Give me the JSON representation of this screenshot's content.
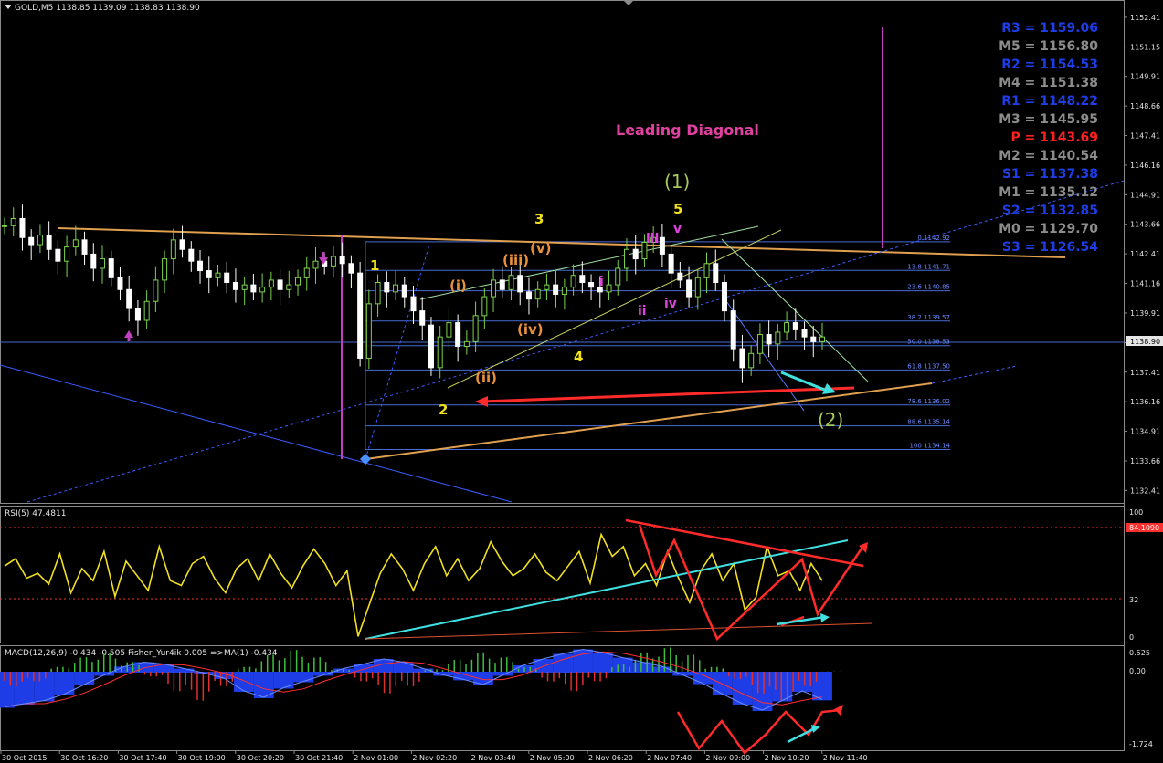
{
  "symbol_header": "GOLD,M5  1138.85 1139.09 1138.83 1138.90",
  "annotations": {
    "leading_diagonal": "Leading Diagonal",
    "wave_1_major": "(1)",
    "wave_2_major": "(2)",
    "wave_1": "1",
    "wave_2": "2",
    "wave_3": "3",
    "wave_4": "4",
    "wave_5": "5",
    "sub_i": "(i)",
    "sub_ii": "(ii)",
    "sub_iii": "(iii)",
    "sub_iv": "(iv)",
    "sub_v": "(v)",
    "m_i": "i",
    "m_ii": "ii",
    "m_iii": "iii",
    "m_iv": "iv",
    "m_v": "v"
  },
  "pivots": [
    {
      "label": "R3",
      "value": "1159.06",
      "color": "#1f3de6"
    },
    {
      "label": "M5",
      "value": "1156.80",
      "color": "#8c8c8c"
    },
    {
      "label": "R2",
      "value": "1154.53",
      "color": "#1f3de6"
    },
    {
      "label": "M4",
      "value": "1151.38",
      "color": "#8c8c8c"
    },
    {
      "label": "R1",
      "value": "1148.22",
      "color": "#1f3de6"
    },
    {
      "label": "M3",
      "value": "1145.95",
      "color": "#8c8c8c"
    },
    {
      "label": "P",
      "value": "1143.69",
      "color": "#ff2020"
    },
    {
      "label": "M2",
      "value": "1140.54",
      "color": "#8c8c8c"
    },
    {
      "label": "S1",
      "value": "1137.38",
      "color": "#1f3de6"
    },
    {
      "label": "M1",
      "value": "1135.12",
      "color": "#8c8c8c"
    },
    {
      "label": "S2",
      "value": "1132.85",
      "color": "#1f3de6"
    },
    {
      "label": "M0",
      "value": "1129.70",
      "color": "#8c8c8c"
    },
    {
      "label": "S3",
      "value": "1126.54",
      "color": "#1f3de6"
    }
  ],
  "fib_levels": [
    {
      "label": "0 1142.92"
    },
    {
      "label": "13.8 1141.71"
    },
    {
      "label": "23.6 1140.85"
    },
    {
      "label": "38.2 1139.57"
    },
    {
      "label": "50.0 1138.53"
    },
    {
      "label": "61.8 1137.50"
    },
    {
      "label": "78.6 1136.02"
    },
    {
      "label": "88.6 1135.14"
    },
    {
      "label": "100 1134.14"
    }
  ],
  "price_axis": [
    "1152.41",
    "1151.15",
    "1149.91",
    "1148.66",
    "1147.41",
    "1146.16",
    "1144.91",
    "1143.66",
    "1142.41",
    "1141.16",
    "1139.91",
    "1138.66",
    "1137.41",
    "1136.16",
    "1134.91",
    "1133.66",
    "1132.41"
  ],
  "current_price": "1138.90",
  "time_axis": [
    "30 Oct 2015",
    "30 Oct 16:20",
    "30 Oct 17:40",
    "30 Oct 19:00",
    "30 Oct 20:20",
    "30 Oct 21:40",
    "2 Nov 01:00",
    "2 Nov 02:20",
    "2 Nov 03:40",
    "2 Nov 05:00",
    "2 Nov 06:20",
    "2 Nov 07:40",
    "2 Nov 09:00",
    "2 Nov 10:20",
    "2 Nov 11:40"
  ],
  "rsi": {
    "header": "RSI(5) 47.4811",
    "axis": [
      "100",
      "32",
      "0"
    ],
    "level_value": "84.1090"
  },
  "macd": {
    "header": "MACD(12,26,9) -0.434 -0.505  Fisher_Yur4ik 0.005  =>MA(1) -0.434",
    "axis": [
      "0.525",
      "0.00",
      "-1.724"
    ]
  },
  "chart_data": {
    "type": "candlestick",
    "symbol": "GOLD",
    "timeframe": "M5",
    "ohlc_last": {
      "open": 1138.85,
      "high": 1139.09,
      "low": 1138.83,
      "close": 1138.9
    },
    "price_range": [
      1132.0,
      1152.6
    ],
    "close_series": [
      1143.6,
      1143.9,
      1143.1,
      1142.8,
      1143.2,
      1142.6,
      1142.1,
      1142.7,
      1143.0,
      1142.4,
      1141.8,
      1142.2,
      1141.4,
      1140.9,
      1140.1,
      1139.6,
      1140.4,
      1141.3,
      1142.2,
      1143.0,
      1142.6,
      1142.1,
      1141.7,
      1141.4,
      1141.6,
      1141.2,
      1140.9,
      1141.1,
      1140.8,
      1141.0,
      1141.3,
      1140.9,
      1141.1,
      1141.4,
      1141.8,
      1142.1,
      1141.9,
      1142.3,
      1142.0,
      1141.6,
      1138.0,
      1140.3,
      1141.2,
      1140.8,
      1141.1,
      1140.6,
      1140.0,
      1139.4,
      1137.6,
      1138.9,
      1139.5,
      1138.5,
      1138.7,
      1139.8,
      1140.6,
      1141.3,
      1140.9,
      1141.5,
      1140.8,
      1140.5,
      1140.9,
      1141.1,
      1140.7,
      1141.0,
      1141.5,
      1141.2,
      1141.0,
      1140.8,
      1141.1,
      1141.8,
      1142.6,
      1142.2,
      1142.9,
      1143.1,
      1142.4,
      1141.6,
      1141.3,
      1140.6,
      1141.4,
      1142.0,
      1141.2,
      1140.0,
      1138.4,
      1137.6,
      1138.2,
      1139.0,
      1138.6,
      1139.1,
      1139.5,
      1139.2,
      1138.9,
      1138.7,
      1138.9
    ],
    "rsi_series": [
      60,
      66,
      50,
      54,
      45,
      70,
      38,
      58,
      48,
      72,
      35,
      64,
      52,
      40,
      76,
      48,
      44,
      62,
      68,
      50,
      38,
      58,
      66,
      48,
      70,
      54,
      42,
      60,
      74,
      62,
      44,
      56,
      2,
      28,
      54,
      70,
      58,
      40,
      62,
      76,
      52,
      66,
      48,
      58,
      80,
      64,
      52,
      58,
      70,
      55,
      48,
      60,
      72,
      46,
      86,
      68,
      76,
      52,
      62,
      44,
      72,
      50,
      30,
      56,
      70,
      48,
      62,
      24,
      34,
      76,
      52,
      56,
      40,
      62,
      48
    ],
    "macd_series": [
      -0.55,
      -0.5,
      -0.45,
      -0.35,
      -0.2,
      -0.05,
      0.08,
      0.15,
      0.12,
      0.05,
      -0.02,
      -0.1,
      -0.3,
      -0.4,
      -0.25,
      -0.15,
      -0.05,
      0.05,
      0.12,
      0.2,
      0.15,
      0.05,
      -0.05,
      -0.12,
      -0.2,
      -0.05,
      0.1,
      0.2,
      0.28,
      0.35,
      0.3,
      0.22,
      0.15,
      0.08,
      -0.05,
      -0.18,
      -0.35,
      -0.5,
      -0.6,
      -0.45,
      -0.3,
      -0.434
    ],
    "fisher_series": [
      -0.3,
      -0.2,
      0.1,
      0.3,
      0.4,
      0.2,
      -0.1,
      -0.4,
      -0.6,
      -0.3,
      0.1,
      0.35,
      0.45,
      0.3,
      0.05,
      -0.2,
      -0.45,
      -0.3,
      0.05,
      0.25,
      0.4,
      0.3,
      0.1,
      -0.2,
      -0.4,
      -0.2,
      0.15,
      0.4,
      0.5,
      0.35,
      0.1,
      -0.15,
      -0.45,
      -0.6,
      -0.3,
      0.005
    ]
  }
}
